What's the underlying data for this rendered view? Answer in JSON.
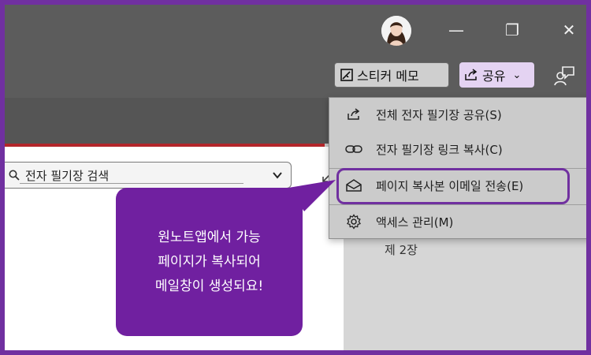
{
  "window": {
    "avatar_icon": "user-avatar",
    "minimize_glyph": "—",
    "restore_glyph": "❐",
    "close_glyph": "✕"
  },
  "toolbar": {
    "sticker_memo_label": "스티커 메모",
    "share_label": "공유",
    "share_dropdown_glyph": "⌄",
    "feedback_icon": "feedback-person-icon"
  },
  "search": {
    "value": "전자 필기장 검색"
  },
  "share_menu": {
    "items": [
      {
        "label": "전체 전자 필기장 공유(S)",
        "icon": "share-icon"
      },
      {
        "label": "전자 필기장 링크 복사(C)",
        "icon": "link-icon"
      },
      {
        "label": "페이지 복사본 이메일 전송(E)",
        "icon": "envelope-icon"
      },
      {
        "label": "액세스 관리(M)",
        "icon": "gear-icon"
      }
    ]
  },
  "page_list": {
    "item": "제 2장"
  },
  "callout": {
    "text": "원노트앱에서 가능\n페이지가 복사되어\n메일창이 생성되요!"
  },
  "colors": {
    "accent_purple": "#7030a0",
    "callout_bg": "#7020a0",
    "share_btn_bg": "#e4d3f2",
    "notebook_red": "#b3262a"
  }
}
